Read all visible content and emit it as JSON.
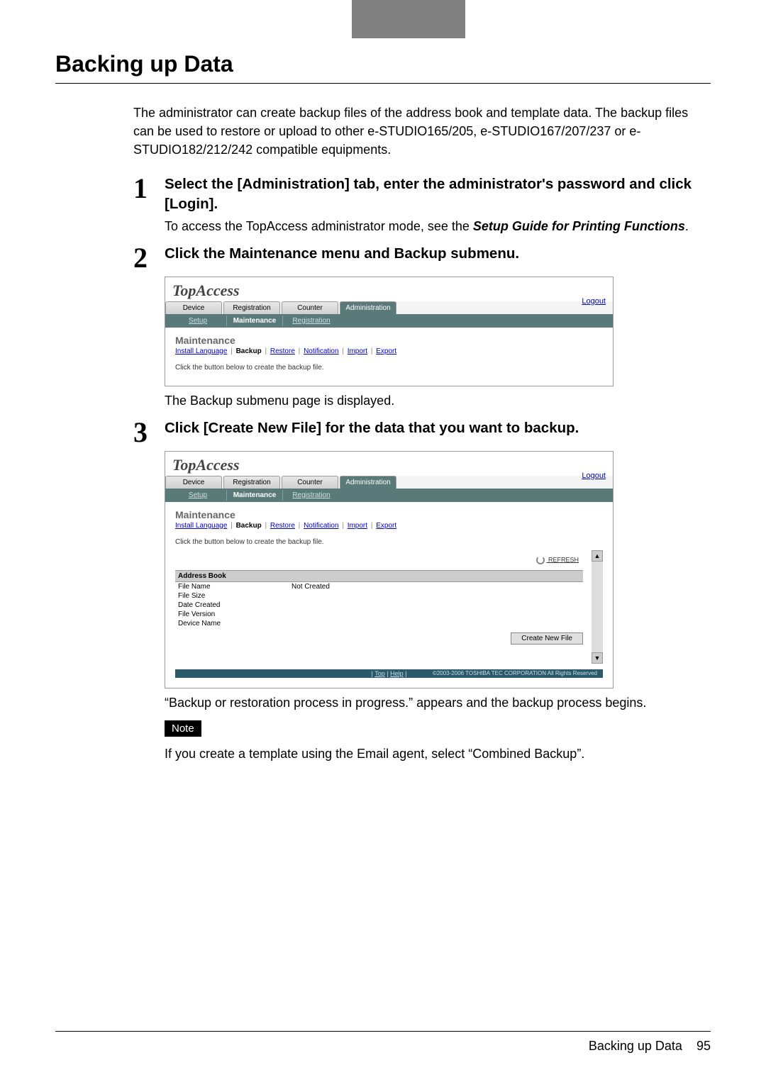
{
  "page_title": "Backing up Data",
  "intro": "The administrator can create backup files of the address book and template data. The backup files can be used to restore or upload to other e-STUDIO165/205, e-STUDIO167/207/237 or e-STUDIO182/212/242 compatible equipments.",
  "steps": {
    "s1": {
      "num": "1",
      "heading": "Select the [Administration] tab, enter the administrator's password and click [Login].",
      "text_prefix": "To access the TopAccess administrator mode, see the ",
      "text_emph": "Setup Guide for Printing Functions",
      "text_suffix": "."
    },
    "s2": {
      "num": "2",
      "heading": "Click the Maintenance menu and Backup submenu.",
      "caption": "The Backup submenu page is displayed."
    },
    "s3": {
      "num": "3",
      "heading": "Click [Create New File] for the data that you want to backup.",
      "caption": "“Backup or restoration process in progress.” appears and the backup process begins."
    }
  },
  "note": {
    "tag": "Note",
    "text": "If you create a template using the Email agent, select “Combined Backup”."
  },
  "footer": {
    "label": "Backing up Data",
    "page_num": "95"
  },
  "ta": {
    "logo": "TopAccess",
    "logout": "Logout",
    "tabs": {
      "device": "Device",
      "registration": "Registration",
      "counter": "Counter",
      "administration": "Administration"
    },
    "subtabs": {
      "setup": "Setup",
      "maintenance": "Maintenance",
      "registration": "Registration"
    },
    "section_title": "Maintenance",
    "submenu": {
      "install_language": "Install Language",
      "backup": "Backup",
      "restore": "Restore",
      "notification": "Notification",
      "import": "Import",
      "export": "Export"
    },
    "hint": "Click the button below to create the backup file.",
    "refresh": "REFRESH",
    "table": {
      "header": "Address Book",
      "file_name": {
        "label": "File Name",
        "value": "Not Created"
      },
      "file_size": {
        "label": "File Size",
        "value": ""
      },
      "date_created": {
        "label": "Date Created",
        "value": ""
      },
      "file_version": {
        "label": "File Version",
        "value": ""
      },
      "device_name": {
        "label": "Device Name",
        "value": ""
      }
    },
    "create_btn": "Create New File",
    "footer_links": {
      "top": "Top",
      "help": "Help"
    },
    "copyright": "©2003-2006 TOSHIBA TEC CORPORATION All Rights Reserved"
  }
}
